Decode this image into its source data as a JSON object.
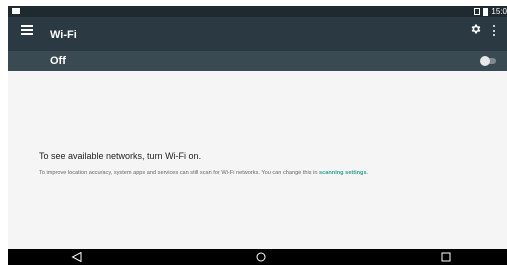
{
  "status_bar": {
    "time": "15:0"
  },
  "app_bar": {
    "title": "Wi-Fi"
  },
  "wifi_toggle": {
    "label": "Off",
    "enabled": false
  },
  "content": {
    "heading": "To see available networks, turn Wi-Fi on.",
    "body_text": "To improve location accuracy, system apps and services can still scan for Wi-Fi networks. You can change this in",
    "link_text": "scanning settings",
    "body_suffix": "."
  },
  "icons": {
    "menu": "menu-icon",
    "settings": "gear-icon",
    "overflow": "more-vert-icon",
    "back": "back-icon",
    "home": "home-icon",
    "recents": "recents-icon"
  },
  "colors": {
    "app_bar": "#2b3a42",
    "toggle_bar": "#3a4a52",
    "link": "#2aa198",
    "nav_bar": "#000000"
  }
}
